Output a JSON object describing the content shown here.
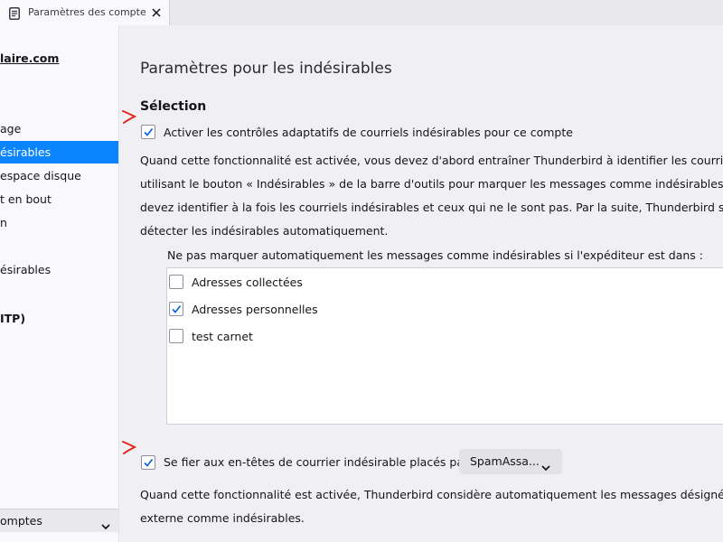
{
  "tab": {
    "title": "Paramètres des comptes Co",
    "icon": "document-icon",
    "close_icon": "close-icon"
  },
  "sidebar": {
    "account": "laire.com",
    "items": [
      {
        "label": "age",
        "selected": false
      },
      {
        "label": "ésirables",
        "selected": true
      },
      {
        "label": "espace disque",
        "selected": false
      },
      {
        "label": "t en bout",
        "selected": false
      },
      {
        "label": "n",
        "selected": false
      },
      {
        "label": "ésirables",
        "selected": false
      }
    ],
    "smtp": "ITP)",
    "bottom_label": "omptes",
    "bottom_icon": "chevron-down-icon"
  },
  "main": {
    "title": "Paramètres pour les indésirables",
    "section": "Sélection",
    "adaptive_checkbox": {
      "label": "Activer les contrôles adaptatifs de courriels indésirables pour ce compte",
      "checked": true
    },
    "adaptive_description": [
      "Quand cette fonctionnalité est activée, vous devez d'abord entraîner Thunderbird à identifier les courriels indési",
      "utilisant le bouton « Indésirables » de la barre d'outils pour marquer les messages comme indésirables ou pas. V",
      "devez identifier à la fois les courriels indésirables et ceux qui ne le sont pas. Par la suite, Thunderbird sera en me",
      "détecter les indésirables automatiquement."
    ],
    "whitelist_caption": "Ne pas marquer automatiquement les messages comme indésirables si l'expéditeur est dans :",
    "address_books": [
      {
        "label": "Adresses collectées",
        "checked": false
      },
      {
        "label": "Adresses personnelles",
        "checked": true
      },
      {
        "label": "test carnet",
        "checked": false
      }
    ],
    "trust_headers_checkbox": {
      "label": "Se fier aux en-têtes de courrier indésirable placés par :",
      "checked": true
    },
    "trust_headers_select": {
      "value": "SpamAssa...",
      "icon": "chevron-down-icon"
    },
    "trust_description": [
      "Quand cette fonctionnalité est activée, Thunderbird considère automatiquement les messages désignés par cet",
      "externe comme indésirables."
    ]
  },
  "colors": {
    "accent": "#0a84ff",
    "annotation": "#e0251b",
    "checkmark": "#0060df"
  }
}
